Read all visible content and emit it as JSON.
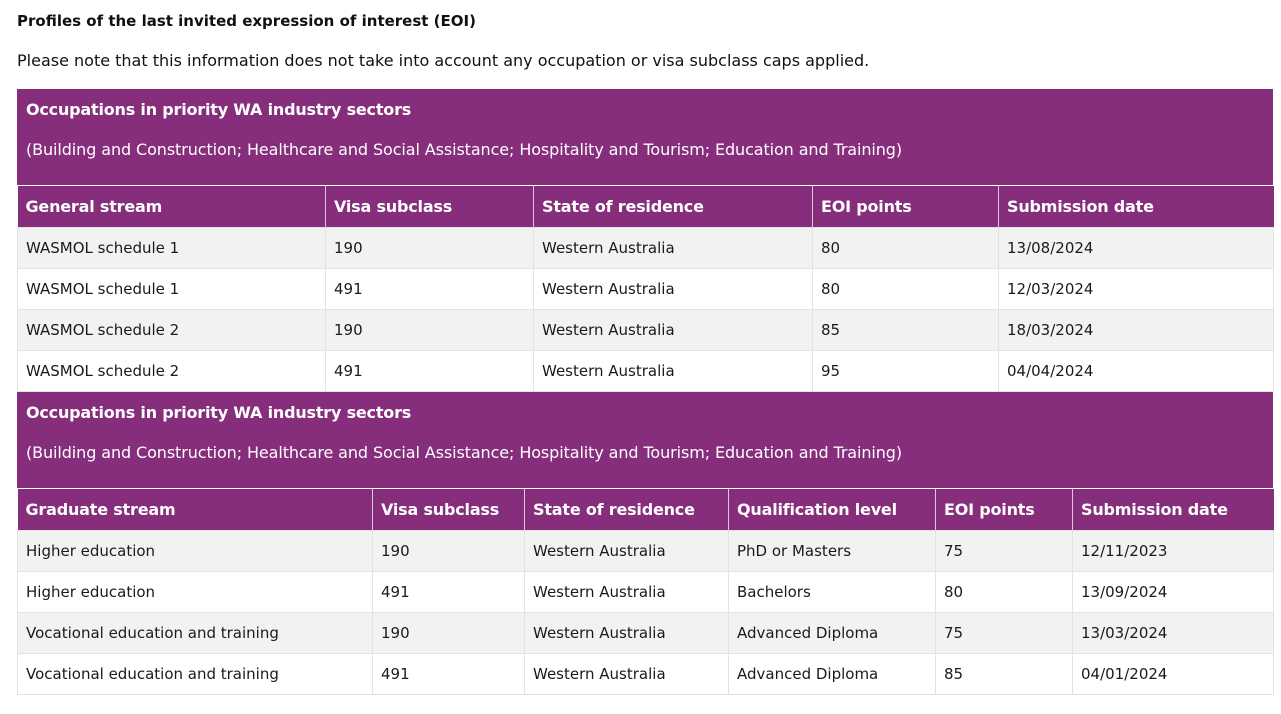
{
  "page": {
    "heading": "Profiles of the last invited expression of interest (EOI)",
    "note": "Please note that this information does not take into account any occupation or visa subclass caps applied."
  },
  "general": {
    "banner_title": "Occupations in priority WA industry sectors",
    "banner_subtitle": "(Building and Construction; Healthcare and Social Assistance; Hospitality and Tourism; Education and Training)",
    "headers": [
      "General stream",
      "Visa subclass",
      "State of residence",
      "EOI points",
      "Submission date"
    ],
    "rows": [
      [
        "WASMOL schedule 1",
        "190",
        "Western Australia",
        "80",
        "13/08/2024"
      ],
      [
        "WASMOL schedule 1",
        "491",
        "Western Australia",
        "80",
        "12/03/2024"
      ],
      [
        "WASMOL schedule 2",
        "190",
        "Western Australia",
        "85",
        "18/03/2024"
      ],
      [
        "WASMOL schedule 2",
        "491",
        "Western Australia",
        "95",
        "04/04/2024"
      ]
    ]
  },
  "graduate": {
    "banner_title": "Occupations in priority WA industry sectors",
    "banner_subtitle": "(Building and Construction; Healthcare and Social Assistance; Hospitality and Tourism; Education and Training)",
    "headers": [
      "Graduate stream",
      "Visa subclass",
      "State of residence",
      "Qualification level",
      "EOI points",
      "Submission date"
    ],
    "rows": [
      [
        "Higher education",
        "190",
        "Western Australia",
        "PhD or Masters",
        "75",
        "12/11/2023"
      ],
      [
        "Higher education",
        "491",
        "Western Australia",
        "Bachelors",
        "80",
        "13/09/2024"
      ],
      [
        "Vocational education and training",
        "190",
        "Western Australia",
        "Advanced Diploma",
        "75",
        "13/03/2024"
      ],
      [
        "Vocational education and training",
        "491",
        "Western Australia",
        "Advanced Diploma",
        "85",
        "04/01/2024"
      ]
    ]
  },
  "colors": {
    "banner": "#862e7c",
    "row_alt": "#f2f2f2"
  }
}
